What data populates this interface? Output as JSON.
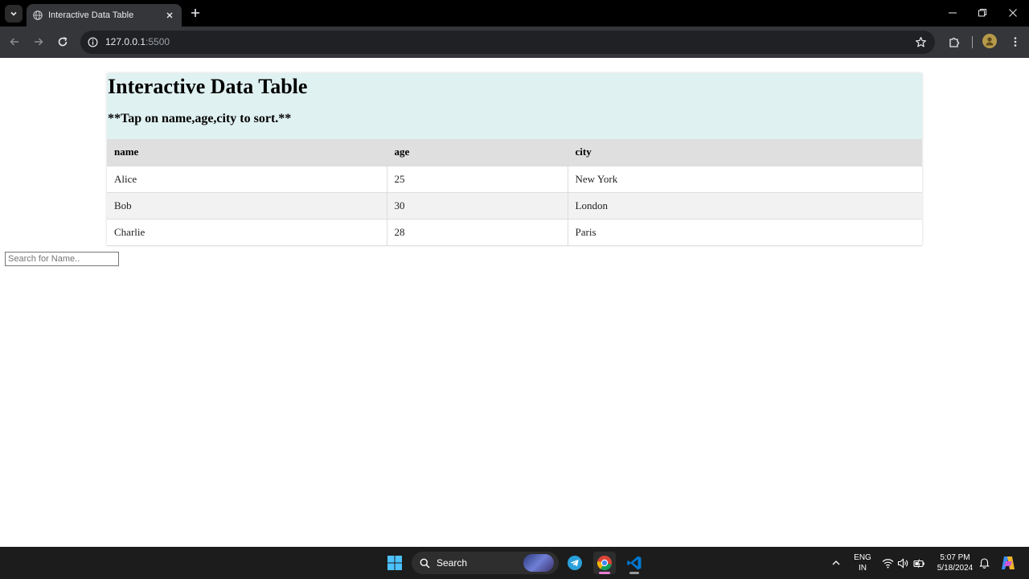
{
  "browser": {
    "tab_title": "Interactive Data Table",
    "url_host": "127.0.0.1",
    "url_port": ":5500"
  },
  "page": {
    "title": "Interactive Data Table",
    "hint": "**Tap on name,age,city to sort.**",
    "search_placeholder": "Search for Name.."
  },
  "table": {
    "headers": [
      "name",
      "age",
      "city"
    ],
    "rows": [
      [
        "Alice",
        "25",
        "New York"
      ],
      [
        "Bob",
        "30",
        "London"
      ],
      [
        "Charlie",
        "28",
        "Paris"
      ]
    ]
  },
  "taskbar": {
    "search_label": "Search",
    "language_top": "ENG",
    "language_bottom": "IN",
    "time": "5:07 PM",
    "date": "5/18/2024"
  },
  "colors": {
    "card_background": "#e0f1f1",
    "header_background": "#dfdfdf",
    "stripe_background": "#f2f2f2"
  }
}
